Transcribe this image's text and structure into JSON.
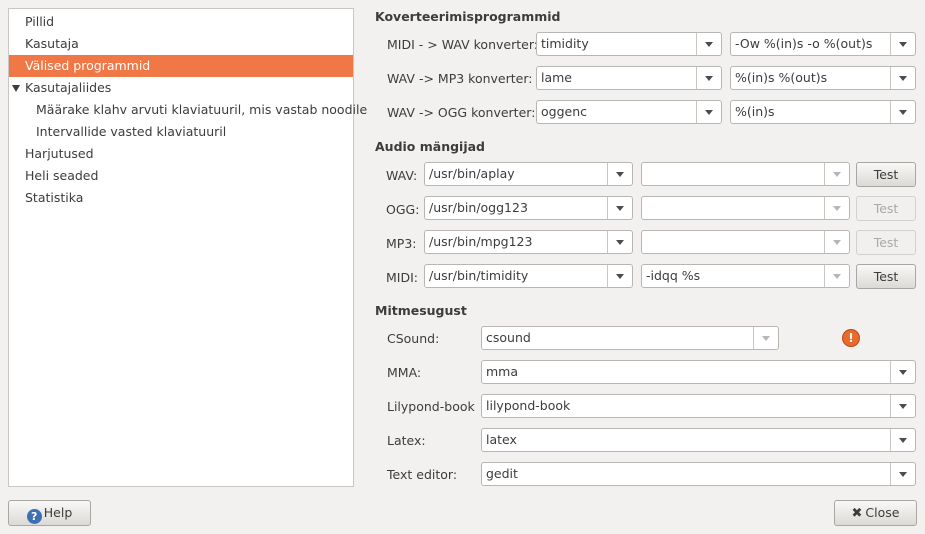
{
  "sidebar": {
    "items": [
      {
        "label": "Pillid"
      },
      {
        "label": "Kasutaja"
      },
      {
        "label": "Välised programmid"
      },
      {
        "label": "Kasutajaliides"
      },
      {
        "label": "Määrake klahv arvuti klaviatuuril, mis vastab noodile"
      },
      {
        "label": "Intervallide vasted klaviatuuril"
      },
      {
        "label": "Harjutused"
      },
      {
        "label": "Heli seaded"
      },
      {
        "label": "Statistika"
      }
    ]
  },
  "converters": {
    "title": "Koverteerimisprogrammid",
    "rows": [
      {
        "label": "MIDI - > WAV konverter:",
        "program": "timidity",
        "args": "-Ow %(in)s -o %(out)s"
      },
      {
        "label": "WAV -> MP3 konverter:",
        "program": "lame",
        "args": "%(in)s %(out)s"
      },
      {
        "label": "WAV -> OGG konverter:",
        "program": "oggenc",
        "args": "%(in)s"
      }
    ]
  },
  "players": {
    "title": "Audio mängijad",
    "test_label": "Test",
    "rows": [
      {
        "label": "WAV:",
        "program": "/usr/bin/aplay",
        "args": ""
      },
      {
        "label": "OGG:",
        "program": "/usr/bin/ogg123",
        "args": ""
      },
      {
        "label": "MP3:",
        "program": "/usr/bin/mpg123",
        "args": ""
      },
      {
        "label": "MIDI:",
        "program": "/usr/bin/timidity",
        "args": "-idqq %s"
      }
    ]
  },
  "misc": {
    "title": "Mitmesugust",
    "rows": [
      {
        "label": "CSound:",
        "value": "csound"
      },
      {
        "label": "MMA:",
        "value": "mma"
      },
      {
        "label": "Lilypond-book",
        "value": "lilypond-book"
      },
      {
        "label": "Latex:",
        "value": "latex"
      },
      {
        "label": "Text editor:",
        "value": "gedit"
      }
    ]
  },
  "footer": {
    "help_label": "Help",
    "close_label": "Close"
  },
  "colors": {
    "selection": "#f07746",
    "warning": "#e96a2b"
  }
}
